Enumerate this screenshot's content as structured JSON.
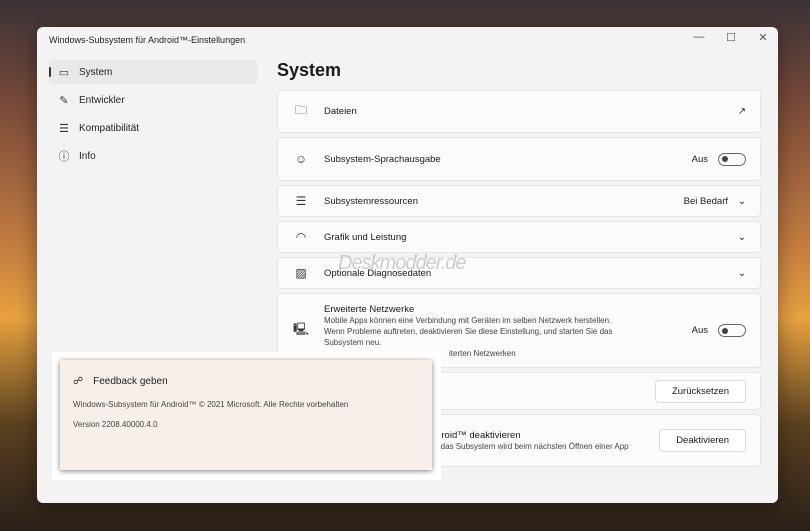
{
  "window": {
    "title": "Windows-Subsystem für Android™-Einstellungen",
    "min": "—",
    "max": "☐",
    "close": "✕"
  },
  "sidebar": {
    "items": [
      {
        "label": "System",
        "icon": "monitor-icon"
      },
      {
        "label": "Entwickler",
        "icon": "tools-icon"
      },
      {
        "label": "Kompatibilität",
        "icon": "sliders-icon"
      },
      {
        "label": "Info",
        "icon": "info-icon"
      }
    ]
  },
  "main": {
    "title": "System",
    "files": {
      "label": "Dateien"
    },
    "speech": {
      "label": "Subsystem-Sprachausgabe",
      "state": "Aus"
    },
    "resources": {
      "label": "Subsystemressourcen",
      "value": "Bei Bedarf"
    },
    "graphics": {
      "label": "Grafik und Leistung"
    },
    "diagnostics": {
      "label": "Optionale Diagnosedaten"
    },
    "network": {
      "label": "Erweiterte Netzwerke",
      "desc1": "Mobile Apps können eine Verbindung mit Geräten im selben Netzwerk herstellen.",
      "desc2": "Wenn Probleme auftreten, deaktivieren Sie diese Einstellung, und starten Sie das",
      "desc3": "Subsystem neu.",
      "desc4": "iterten Netzwerken",
      "state": "Aus"
    },
    "reset": {
      "button": "Zurücksetzen"
    },
    "deactivate": {
      "label": "idroid™ deaktivieren",
      "desc": "d das Subsystem wird beim nächsten Öffnen einer App",
      "button": "Deaktivieren"
    }
  },
  "popup": {
    "feedback": "Feedback geben",
    "copyright": "Windows-Subsystem für Android™ © 2021 Microsoft. Alle Rechte vorbehalten",
    "version": "Version 2208.40000.4.0"
  },
  "watermark": "Deskmodder.de"
}
